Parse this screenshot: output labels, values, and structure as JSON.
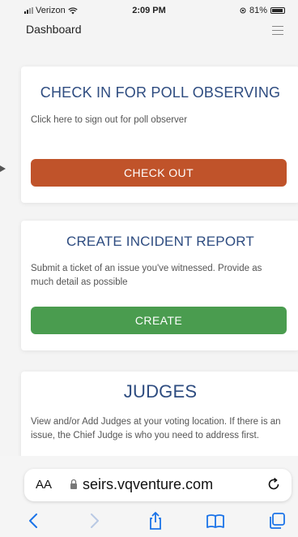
{
  "status_bar": {
    "carrier": "Verizon",
    "time": "2:09 PM",
    "battery": "81%"
  },
  "header": {
    "title": "Dashboard"
  },
  "cards": [
    {
      "title": "CHECK IN FOR POLL OBSERVING",
      "description": "Click here to sign out for poll observer",
      "button_label": "CHECK OUT",
      "button_color": "#c0532a"
    },
    {
      "title": "CREATE INCIDENT REPORT",
      "description": "Submit a ticket of an issue you've witnessed. Provide as much detail as possible",
      "button_label": "CREATE",
      "button_color": "#4a9c4f"
    },
    {
      "title": "JUDGES",
      "description": "View and/or Add Judges at your voting location. If there is an issue, the Chief Judge is who you need to address first."
    }
  ],
  "browser": {
    "text_size_label": "AA",
    "url": "seirs.vqventure.com",
    "nav_icons": [
      "back-icon",
      "forward-icon",
      "share-icon",
      "bookmarks-icon",
      "tabs-icon"
    ]
  },
  "colors": {
    "title_blue": "#2e4c80",
    "browser_blue": "#1a73e8"
  }
}
